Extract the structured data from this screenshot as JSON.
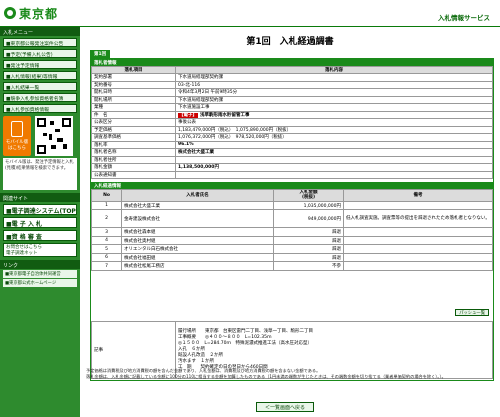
{
  "header": {
    "logo_text": "東京都",
    "service_name": "入札情報サービス",
    "brand_color": "#1a8a1a"
  },
  "sidebar": {
    "section_menu": "入札メニュー",
    "items": [
      "■東京都公報発注案件公告",
      "■予定(予備入札公告)",
      "■発注予定情報",
      "■入札情報(結果)等情報",
      "■入札結果一覧",
      "■競争入札参加資格者名簿",
      "■入札参加資格情報"
    ],
    "mobile": {
      "title": "モバイル版",
      "sub": "はこちら",
      "note": "モバイル版は、発注予定情報と入札(見積)結果情報を検索できます。"
    },
    "section_related": "関連サイト",
    "big_links": [
      "■電子調達システム(TOP)",
      "■電 子 入 札",
      "■資 格 審 査"
    ],
    "hint": "お問合せはこちら\n電子調達ネット",
    "section_links": "リンク",
    "links": [
      "■東京都電子自治体共同運営",
      "■東京都公式ホームページ"
    ]
  },
  "main": {
    "title": "第1回　入札経過調書",
    "round_tab": "第1回",
    "winner_section": "落札者情報",
    "table_head": [
      "落札項目",
      "落札内容"
    ],
    "rows": [
      {
        "label": "契約部署",
        "value": "下水道局経理部契約課"
      },
      {
        "label": "契約番号",
        "value": "03-北-116"
      },
      {
        "label": "開札日時",
        "value": "令和4年3月2日 午前9時35分"
      },
      {
        "label": "開札場所",
        "value": "下水道局経理部契約課"
      },
      {
        "label": "業種",
        "value": "下水道施設工事"
      },
      {
        "label": "件　名",
        "value_tag": "【電子】",
        "value": "浅草駒形雨水貯留管工事"
      },
      {
        "label": "公表区分",
        "value": "事後公表"
      },
      {
        "label": "予定価格",
        "value": "1,183,479,000円（税込）　1,075,890,000円（税抜）"
      },
      {
        "label": "調査基準価格",
        "value": "1,076,372,000円（税込）　978,520,000円（税抜）"
      },
      {
        "label": "落札率",
        "value": "96.1%"
      },
      {
        "label": "落札者名称",
        "value": "株式会社大盛工業"
      },
      {
        "label": "落札者住所",
        "value": ""
      },
      {
        "label": "落札金額",
        "value": "1,138,500,000円"
      },
      {
        "label": "公表通知書",
        "value": ""
      }
    ],
    "bid_section": "入札経過情報",
    "bid_head": [
      "No",
      "入札者氏名",
      "入札金額\n(税抜)",
      "備考"
    ],
    "bids": [
      {
        "no": "1",
        "name": "株式会社大盛工業",
        "amount": "1,035,000,000円",
        "note": ""
      },
      {
        "no": "2",
        "name": "金寿建設株式会社",
        "amount": "949,000,000円",
        "note": "低入札調査実施。調査票等の提出を辞退されたため落札者となりない。"
      },
      {
        "no": "3",
        "name": "株式会社森本組",
        "amount": "辞退",
        "note": ""
      },
      {
        "no": "4",
        "name": "株式会社奥村組",
        "amount": "辞退",
        "note": ""
      },
      {
        "no": "5",
        "name": "オリエンタル白石株式会社",
        "amount": "辞退",
        "note": ""
      },
      {
        "no": "6",
        "name": "株式会社福田組",
        "amount": "辞退",
        "note": ""
      },
      {
        "no": "7",
        "name": "株式会社松尾工務店",
        "amount": "不参",
        "note": ""
      }
    ],
    "more_button": "パッシュ一覧",
    "remarks_label": "記事",
    "remarks_lines": [
      "履行場所　　東京都　台東区雷門二丁目、浅草一丁目、駒形二丁目",
      "工事概要　　◎４００～８００　L=102.35ｍ",
      "◎１５００　L=284.70ｍ　特殊泥濃式推進工法（高水圧対応型）",
      "入孔　６か所",
      "既設人孔改造　２か所",
      "汚水ます　１か所",
      "工　期　　契約確定の日の翌日から460日間"
    ],
    "notes": [
      "予定価格は消費税及び地方消費税の額を含んだ金額であり、入札金額は、消費税及び地方消費税の額を含まない金額である。",
      "落札金額は、入札金額に記載している金額に100分の110に相当する金額を加算したものである（1円未満の端数が生じたときは、その端数金額を切り捨てる（業者単価契約の場合を除く）。）。"
    ],
    "back_button": "＜一覧画面へ戻る"
  }
}
